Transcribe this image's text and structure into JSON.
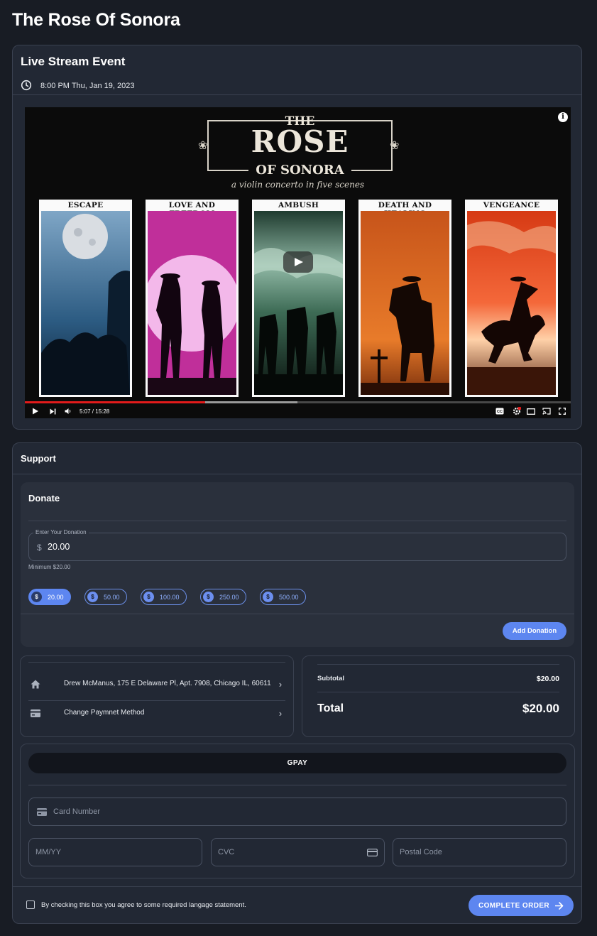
{
  "page": {
    "title": "The Rose Of Sonora"
  },
  "event": {
    "title": "Live Stream Event",
    "datetime": "8:00 PM Thu, Jan 19, 2023",
    "video": {
      "heading_the": "THE",
      "heading_rose": "ROSE",
      "heading_sonora": "OF SONORA",
      "subtitle": "a violin concerto in five scenes",
      "panels": [
        "ESCAPE",
        "LOVE AND FREEDOM",
        "AMBUSH",
        "DEATH AND HEALING",
        "VENGEANCE"
      ],
      "time_display": "5:07 / 15:28",
      "progress_fraction": 0.33,
      "buffered_fraction": 0.5
    }
  },
  "support": {
    "title": "Support",
    "donate": {
      "title": "Donate",
      "field_label": "Enter Your Donation",
      "currency": "$",
      "value": "20.00",
      "minimum_note": "Minimum $20.00",
      "presets": [
        "20.00",
        "50.00",
        "100.00",
        "250.00",
        "500.00"
      ],
      "selected_preset": "20.00",
      "add_button": "Add Donation"
    },
    "address": "Drew McManus, 175 E Delaware Pl, Apt. 7908, Chicago IL, 60611",
    "payment_method_label": "Change Paymnet Method",
    "summary": {
      "subtotal_label": "Subtotal",
      "subtotal_value": "$20.00",
      "total_label": "Total",
      "total_value": "$20.00"
    },
    "payment": {
      "gpay_label": "GPAY",
      "card_number_placeholder": "Card Number",
      "expiry_placeholder": "MM/YY",
      "cvc_placeholder": "CVC",
      "postal_placeholder": "Postal Code"
    },
    "agreement": "By checking this box you agree to some required langage statement.",
    "complete_button": "COMPLETE ORDER"
  },
  "colors": {
    "accent": "#5d86f0",
    "background": "#181c24",
    "card": "#222834"
  }
}
